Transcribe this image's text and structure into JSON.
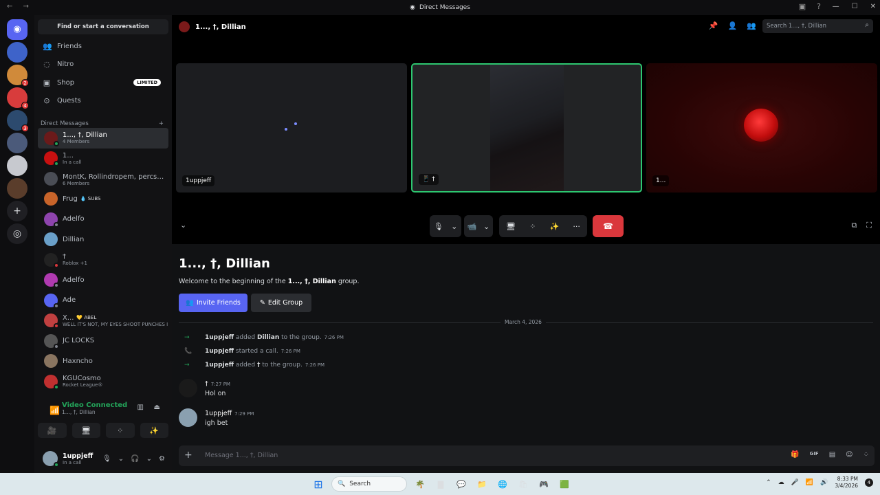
{
  "window": {
    "title": "Direct Messages",
    "nav": "← →",
    "tb_icons": [
      "▣",
      "?"
    ],
    "controls": [
      "—",
      "☐",
      "✕"
    ]
  },
  "guilds": {
    "items": [
      {
        "name": "discord-home",
        "color": "#5865f2",
        "badge": ""
      },
      {
        "name": "server-1",
        "color": "#3e63c9",
        "badge": ""
      },
      {
        "name": "server-2",
        "color": "#d08a3a",
        "badge": "2"
      },
      {
        "name": "server-3",
        "color": "#d83c3c",
        "badge": "4"
      },
      {
        "name": "server-4",
        "color": "#2c4a6e",
        "badge": "3"
      },
      {
        "name": "server-5",
        "color": "#4b5a7a",
        "badge": ""
      },
      {
        "name": "server-6",
        "color": "#c7c9cf",
        "badge": ""
      },
      {
        "name": "server-7",
        "color": "#5a3d2b",
        "badge": ""
      }
    ],
    "add_glyph": "+",
    "explore_glyph": "◎"
  },
  "sidebar": {
    "search_label": "Find or start a conversation",
    "nav": [
      {
        "label": "Friends",
        "icon": "👥"
      },
      {
        "label": "Nitro",
        "icon": "◌"
      },
      {
        "label": "Shop",
        "icon": "▣",
        "badge": "LIMITED"
      },
      {
        "label": "Quests",
        "icon": "⊙"
      }
    ],
    "dm_header": "Direct Messages",
    "dm_add": "+",
    "dms": [
      {
        "name": "1..., †, Dillian",
        "sub": "4 Members",
        "color": "#6b1a1a",
        "status": "#23a55a"
      },
      {
        "name": "1...",
        "sub": "In a call",
        "color": "#c81010",
        "status": "#23a55a"
      },
      {
        "name": "MontK, Rollindropem, percsツ, ...",
        "sub": "6 Members",
        "color": "#4a4d55",
        "status": ""
      },
      {
        "name": "Frug",
        "sub": "",
        "tag": "💧 SUBS",
        "color": "#c8642a",
        "status": ""
      },
      {
        "name": "Adelfo",
        "sub": "",
        "color": "#8e44ad",
        "status": "#80848e"
      },
      {
        "name": "Dillian",
        "sub": "",
        "color": "#6aa0c9",
        "status": ""
      },
      {
        "name": "†",
        "sub": "Roblox +1",
        "color": "#222",
        "status": "#da373c"
      },
      {
        "name": "Adelfo",
        "sub": "",
        "color": "#b03ab0",
        "status": "#80848e"
      },
      {
        "name": "Ade",
        "sub": "",
        "color": "#5865f2",
        "status": "#80848e"
      },
      {
        "name": "X...",
        "tag": "💛 ABEL",
        "sub": "WELL IT'S NOT, MY EYES SHOOT PUNCHES I",
        "color": "#c04040",
        "status": "#da373c"
      },
      {
        "name": "JC LOCKS",
        "sub": "",
        "color": "#555",
        "status": "#80848e"
      },
      {
        "name": "Haxncho",
        "sub": "",
        "color": "#8a7560",
        "status": ""
      },
      {
        "name": "KGUCosmo",
        "sub": "Rocket League®",
        "color": "#c03030",
        "status": "#23a55a"
      }
    ]
  },
  "voice": {
    "title": "Video Connected",
    "channel": "1..., †, Dillian",
    "signal_glyph": "📶",
    "header_icons": [
      "▥",
      "⏏"
    ],
    "buttons": [
      "🎥",
      "🖥",
      "⁘",
      "✨"
    ]
  },
  "user": {
    "name": "1uppjeff",
    "status": "In a call",
    "controls": [
      "🎙",
      "⌄",
      "🎧",
      "⌄",
      "⚙"
    ]
  },
  "header": {
    "title": "1..., †, Dillian",
    "search_placeholder": "Search 1..., †, Dillian",
    "tools": [
      "📌",
      "👤",
      "👥"
    ]
  },
  "call": {
    "tiles": [
      {
        "label": "1uppjeff"
      },
      {
        "label": "📱 †"
      },
      {
        "label": "1..."
      }
    ],
    "controls": {
      "mic": "🎙",
      "mic_chevron": "⌄",
      "camera": "📹",
      "camera_chevron": "⌄",
      "share": "🖥",
      "activity": "⁘",
      "soundboard": "✨",
      "more": "···",
      "end": "☎"
    },
    "collapse": "⌄",
    "popout": "⧉",
    "fullscreen": "⛶"
  },
  "chat": {
    "group_title": "1..., †, Dillian",
    "welcome_prefix": "Welcome to the beginning of the ",
    "welcome_name": "1..., †, Dillian",
    "welcome_suffix": " group.",
    "invite_label": "Invite Friends",
    "edit_label": "Edit Group",
    "date": "March 4, 2026",
    "system": [
      {
        "icon": "→",
        "actor": "1uppjeff",
        "verb": " added ",
        "target": "Dillian",
        "tail": " to the group.",
        "time": "7:26 PM"
      },
      {
        "icon": "📞",
        "actor": "1uppjeff",
        "verb": " started a call.",
        "target": "",
        "tail": "",
        "time": "7:26 PM"
      },
      {
        "icon": "→",
        "actor": "1uppjeff",
        "verb": " added ",
        "target": "†",
        "tail": " to the group.",
        "time": "7:26 PM"
      }
    ],
    "messages": [
      {
        "author": "†",
        "time": "7:27 PM",
        "text": "Hol on",
        "color": "#1a1a1a"
      },
      {
        "author": "1uppjeff",
        "time": "7:29 PM",
        "text": "igh bet",
        "color": "#8aa0b0"
      }
    ],
    "composer_placeholder": "Message 1..., †, Dillian",
    "composer_plus": "+",
    "composer_icons": [
      "🎁",
      "GIF",
      "▤",
      "☺",
      "⁘"
    ]
  },
  "taskbar": {
    "start_glyph": "⊞",
    "search_glyph": "🔍",
    "search_label": "Search",
    "apps": [
      "🌴",
      "▇",
      "💬",
      "📁",
      "🌐",
      "🛍",
      "🎮",
      "🟩"
    ],
    "tray": [
      "⌃",
      "☁",
      "🎤",
      "📶",
      "🔊"
    ],
    "time": "8:33 PM",
    "date": "3/4/2026",
    "notifications": "4"
  }
}
